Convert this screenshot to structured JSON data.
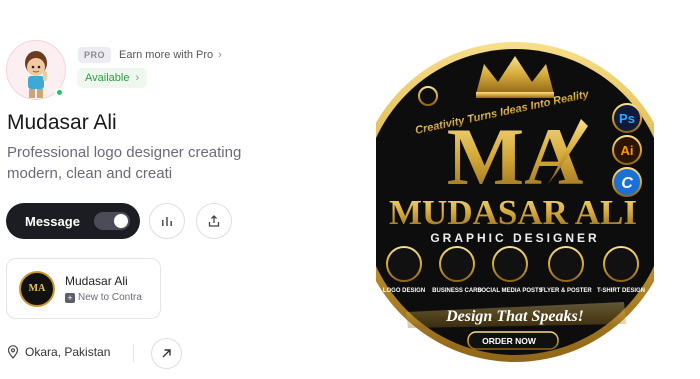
{
  "profile": {
    "name": "Mudasar Ali",
    "tagline": "Professional logo designer creating modern, clean and creati",
    "pro_badge": "PRO",
    "pro_link": "Earn more with Pro",
    "availability": "Available",
    "location": "Okara, Pakistan"
  },
  "actions": {
    "message_label": "Message"
  },
  "contra_card": {
    "title": "Mudasar Ali",
    "subtitle": "New to Contra"
  },
  "banner": {
    "tagline": "Creativity Turns Ideas Into Reality",
    "brand": "MUDASAR ALI",
    "role": "GRAPHIC DESIGNER",
    "monogram": "MA",
    "tools": [
      "Ps",
      "Ai",
      "C"
    ],
    "services": [
      "LOGO DESIGN",
      "BUSINESS CARD",
      "SOCIAL MEDIA POSTS",
      "FLYER & POSTER",
      "T-SHIRT DESIGN"
    ],
    "slogan": "Design That Speaks!",
    "cta": "ORDER NOW",
    "mini_mark": "MA"
  },
  "colors": {
    "gold": "#d4a93a",
    "dark": "#111111",
    "online": "#22c55e",
    "available_text": "#2f9a45"
  }
}
